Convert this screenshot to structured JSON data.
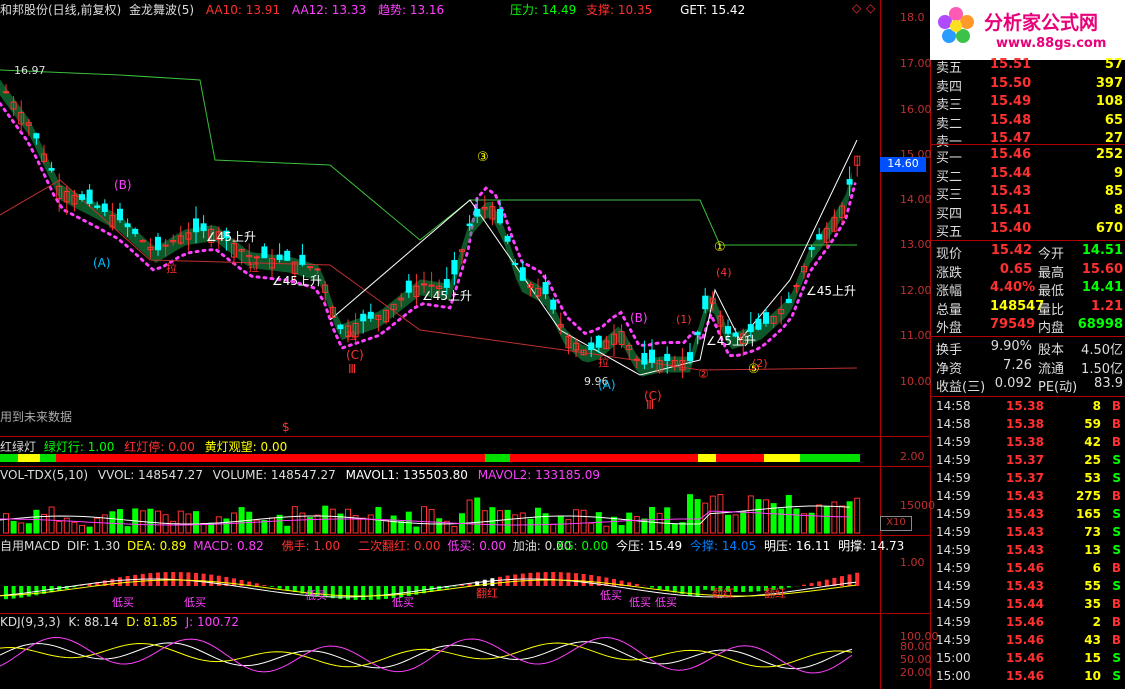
{
  "colors": {
    "up": "#ff3030",
    "down": "#00ffff",
    "grid": "#b00000",
    "label_red": "#ff3030",
    "label_green": "#00ff00",
    "label_yellow": "#ffff00",
    "label_magenta": "#ff40ff",
    "label_cyan": "#00c0ff",
    "white": "#ffffff"
  },
  "header": {
    "title": "和邦股份(日线,前复权)",
    "indicator": "金龙舞波(5)",
    "aa10": "AA10: 13.91",
    "aa12": "AA12: 13.33",
    "trend": "趋势: 13.16",
    "pressure": "压力: 14.49",
    "support": "支撑: 10.35",
    "get": "GET: 15.42"
  },
  "main_notes": {
    "future_data": "用到未来数据",
    "dollar": "$"
  },
  "y_axis": {
    "labels": [
      "18.0",
      "17.00",
      "16.00",
      "15.00",
      "14.00",
      "13.00",
      "12.00",
      "11.00",
      "10.00"
    ],
    "current": "14.60"
  },
  "chart_marks": {
    "high": "16.97",
    "low": "9.96",
    "wave_B1": "(B)",
    "wave_A1": "(A)",
    "wave_C1": "(C)",
    "wave_III1": "Ⅲ",
    "wave_B2": "(B)",
    "wave_A2": "(A)",
    "wave_C2": "(C)",
    "wave_III2": "Ⅲ",
    "circled_3": "③",
    "circled_1": "①",
    "circled_2": "②",
    "circled_5": "⑤",
    "paren_1": "(1)",
    "paren_2": "(2)",
    "paren_4": "(4)",
    "rise1": "45上升",
    "rise2": "45上升",
    "rise3": "45上升",
    "rise4": "45上升",
    "rise5": "45上升",
    "la1": "拉",
    "la2": "拉",
    "la3": "拉",
    "la4": "拉"
  },
  "traffic": {
    "title": "红绿灯",
    "green": "绿灯行: 1.00",
    "red": "红灯停: 0.00",
    "yellow": "黄灯观望: 0.00",
    "axis": "2.00"
  },
  "volume": {
    "title": "VOL-TDX(5,10)",
    "vvol": "VVOL: 148547.27",
    "volume": "VOLUME: 148547.27",
    "mavol1": "MAVOL1: 135503.80",
    "mavol2": "MAVOL2: 133185.09",
    "axis": "15000",
    "unit": "X10"
  },
  "macd": {
    "title": "自用MACD",
    "dif": "DIF: 1.30",
    "dea": "DEA: 0.89",
    "macd": "MACD: 0.82",
    "foshou": "佛手: 1.00",
    "erci": "二次翻红: 0.00",
    "dimai": "低买: 0.00",
    "jiayou": "加油: 0.00",
    "xg": "XG: 0.00",
    "jinya": "今压: 15.49",
    "jincheng": "今撑: 14.05",
    "mingya": "明压: 16.11",
    "mingcheng": "明撑: 14.73",
    "axis": "1.00",
    "marks": [
      "低买",
      "低买",
      "低买",
      "低买",
      "低买",
      "低买",
      "低买",
      "翻红",
      "翻红",
      "翻红"
    ]
  },
  "kdj": {
    "title": "KDJ(9,3,3)",
    "k": "K: 88.14",
    "d": "D: 81.85",
    "j": "J: 100.72",
    "axis": [
      "100.00",
      "80.00",
      "50.00",
      "20.00"
    ]
  },
  "logo": {
    "name": "分析家公式网",
    "url": "www.88gs.com"
  },
  "quote": {
    "asks": [
      {
        "label": "卖五",
        "price": "15.51",
        "vol": "57"
      },
      {
        "label": "卖四",
        "price": "15.50",
        "vol": "397"
      },
      {
        "label": "卖三",
        "price": "15.49",
        "vol": "108"
      },
      {
        "label": "卖二",
        "price": "15.48",
        "vol": "65"
      },
      {
        "label": "卖一",
        "price": "15.47",
        "vol": "27"
      }
    ],
    "bids": [
      {
        "label": "买一",
        "price": "15.46",
        "vol": "252"
      },
      {
        "label": "买二",
        "price": "15.44",
        "vol": "9"
      },
      {
        "label": "买三",
        "price": "15.43",
        "vol": "85"
      },
      {
        "label": "买四",
        "price": "15.41",
        "vol": "8"
      },
      {
        "label": "买五",
        "price": "15.40",
        "vol": "670"
      }
    ],
    "stats": [
      {
        "l1": "现价",
        "v1": "15.42",
        "l2": "今开",
        "v2": "14.51"
      },
      {
        "l1": "涨跌",
        "v1": "0.65",
        "l2": "最高",
        "v2": "15.60"
      },
      {
        "l1": "涨幅",
        "v1": "4.40%",
        "l2": "最低",
        "v2": "14.41"
      },
      {
        "l1": "总量",
        "v1": "148547",
        "l2": "量比",
        "v2": "1.21"
      },
      {
        "l1": "外盘",
        "v1": "79549",
        "l2": "内盘",
        "v2": "68998"
      }
    ],
    "stats2": [
      {
        "l1": "换手",
        "v1": "9.90%",
        "l2": "股本",
        "v2": "4.50亿"
      },
      {
        "l1": "净资",
        "v1": "7.26",
        "l2": "流通",
        "v2": "1.50亿"
      },
      {
        "l1": "收益(三)",
        "v1": "0.092",
        "l2": "PE(动)",
        "v2": "83.9"
      }
    ],
    "ticks": [
      {
        "t": "14:58",
        "p": "15.38",
        "v": "8",
        "s": "B"
      },
      {
        "t": "14:58",
        "p": "15.38",
        "v": "59",
        "s": "B"
      },
      {
        "t": "14:59",
        "p": "15.38",
        "v": "42",
        "s": "B"
      },
      {
        "t": "14:59",
        "p": "15.37",
        "v": "25",
        "s": "S"
      },
      {
        "t": "14:59",
        "p": "15.37",
        "v": "53",
        "s": "S"
      },
      {
        "t": "14:59",
        "p": "15.43",
        "v": "275",
        "s": "B"
      },
      {
        "t": "14:59",
        "p": "15.43",
        "v": "165",
        "s": "S"
      },
      {
        "t": "14:59",
        "p": "15.43",
        "v": "73",
        "s": "S"
      },
      {
        "t": "14:59",
        "p": "15.43",
        "v": "13",
        "s": "S"
      },
      {
        "t": "14:59",
        "p": "15.46",
        "v": "6",
        "s": "B"
      },
      {
        "t": "14:59",
        "p": "15.43",
        "v": "55",
        "s": "S"
      },
      {
        "t": "14:59",
        "p": "15.44",
        "v": "35",
        "s": "B"
      },
      {
        "t": "14:59",
        "p": "15.46",
        "v": "2",
        "s": "B"
      },
      {
        "t": "14:59",
        "p": "15.46",
        "v": "43",
        "s": "B"
      },
      {
        "t": "15:00",
        "p": "15.46",
        "v": "15",
        "s": "S"
      },
      {
        "t": "15:00",
        "p": "15.46",
        "v": "10",
        "s": "S"
      }
    ]
  }
}
